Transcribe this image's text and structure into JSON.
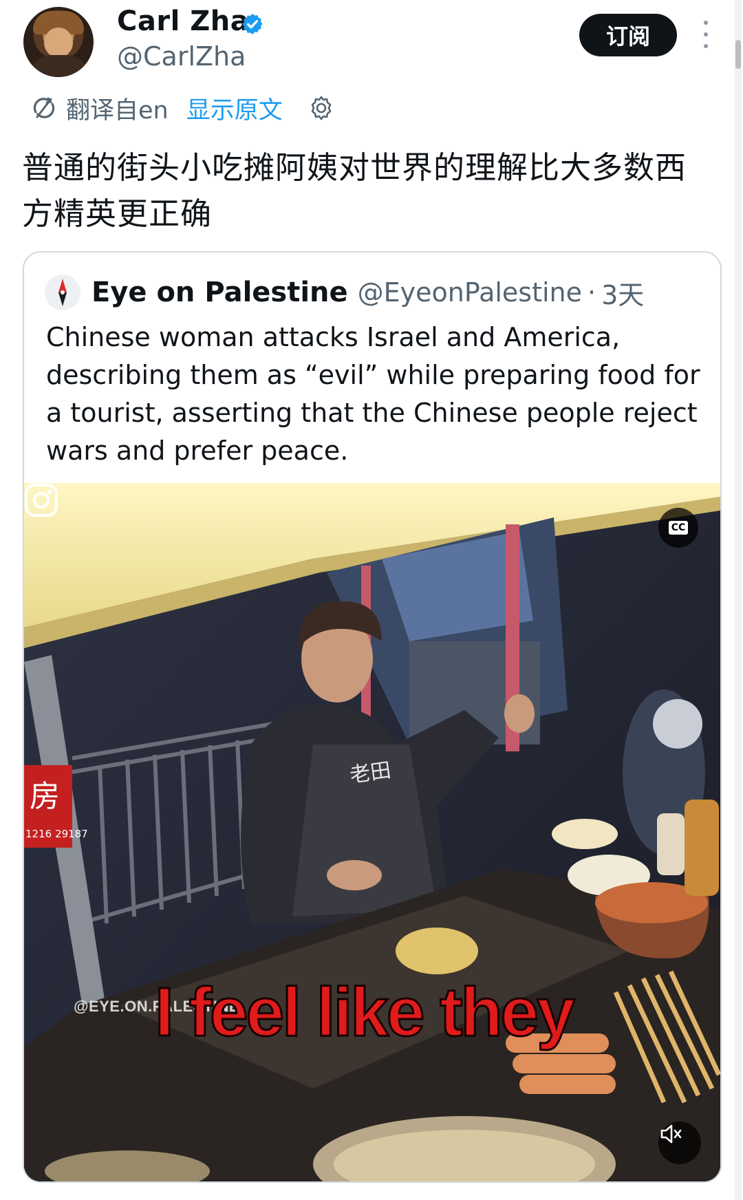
{
  "author": {
    "display_name": "Carl Zha",
    "handle": "@CarlZha",
    "verified_icon": "verified-badge-icon"
  },
  "header": {
    "subscribe_label": "订阅",
    "more_icon": "more-vertical-icon"
  },
  "translation": {
    "translated_from": "翻译自en",
    "show_original": "显示原文",
    "translate_icon": "translate-icon",
    "settings_icon": "gear-icon"
  },
  "tweet": {
    "text": "普通的街头小吃摊阿姨对世界的理解比大多数西方精英更正确"
  },
  "quote": {
    "author_name": "Eye on Palestine",
    "handle": "@EyeonPalestine",
    "separator": "·",
    "time": "3天",
    "text": "Chinese woman attacks Israel and America, describing them as “evil” while preparing food for a tourist, asserting that the Chinese people reject wars and prefer peace.",
    "media": {
      "caption": "I feel like they",
      "watermark": "@EYE.ON.PALESTINE",
      "apron_text": "老田",
      "sign_text": "1216 29187",
      "cc_label": "CC",
      "instagram_icon": "instagram-icon",
      "mute_icon": "speaker-muted-icon",
      "cc_icon": "closed-captions-icon"
    }
  },
  "colors": {
    "link": "#1d9bf0",
    "secondary_text": "#536471",
    "primary_text": "#0f1419",
    "caption_red": "#e01b1b"
  }
}
